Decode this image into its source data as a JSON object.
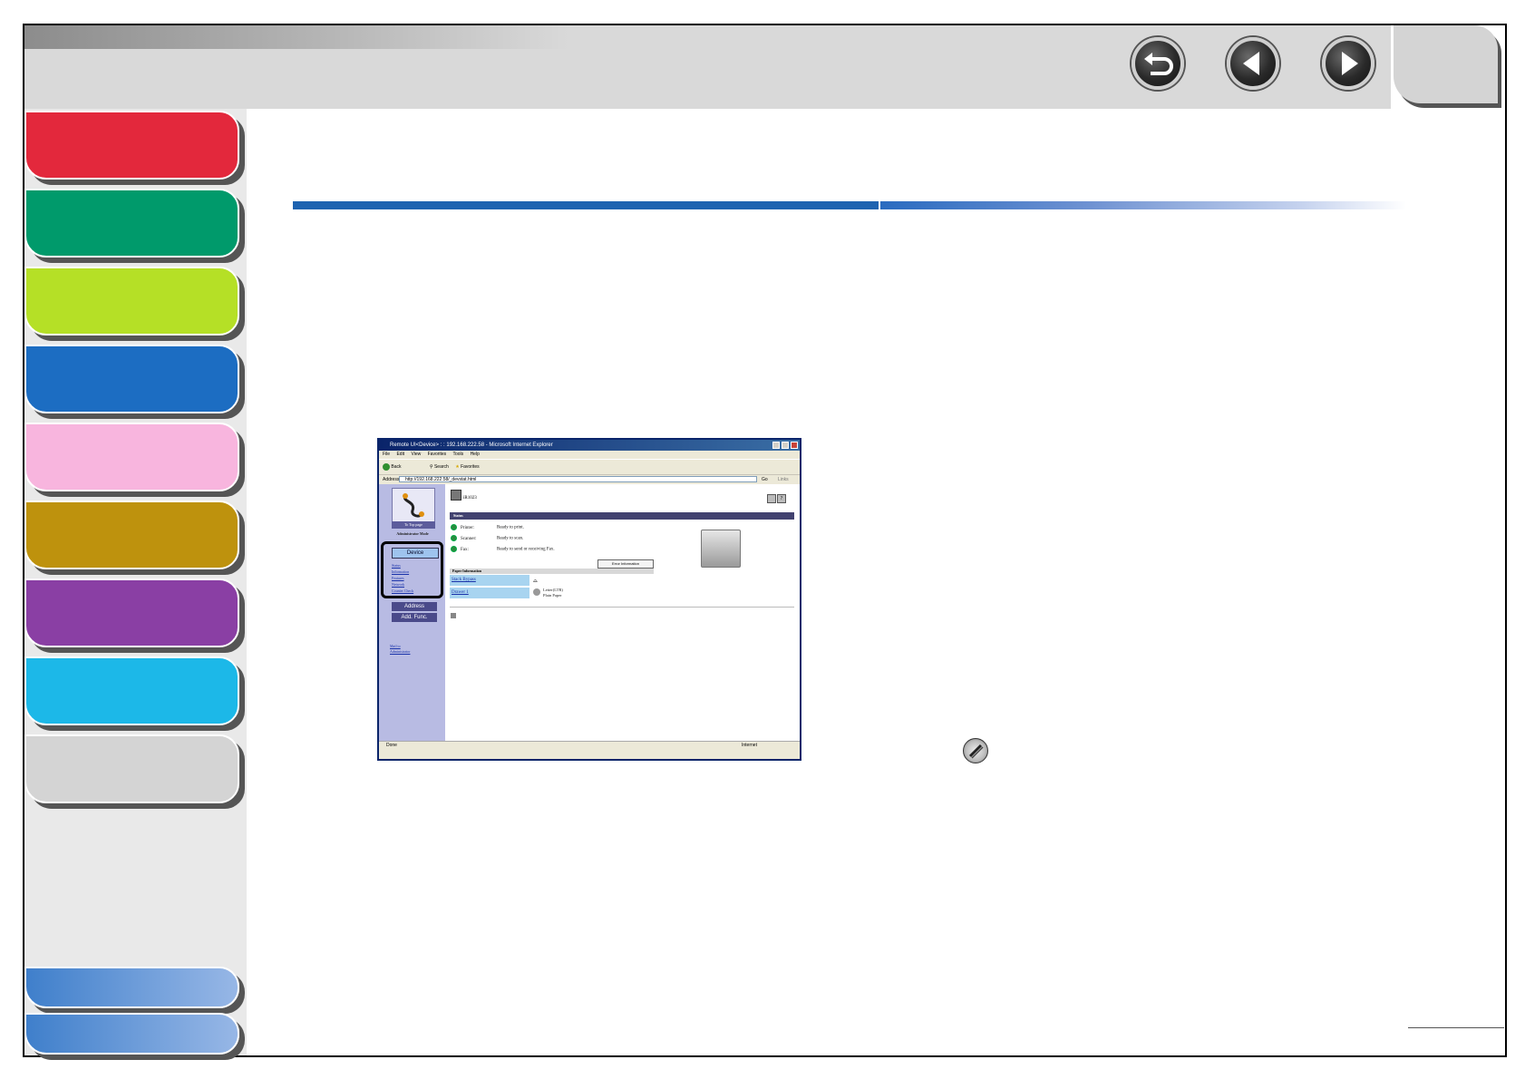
{
  "header": {
    "nav_buttons": [
      {
        "name": "back-icon",
        "glyph": "↺"
      },
      {
        "name": "previous-page-icon",
        "glyph": "◀"
      },
      {
        "name": "next-page-icon",
        "glyph": "▶"
      }
    ]
  },
  "sidebar": {
    "tab_colors": [
      "#e3283c",
      "#009a6b",
      "#b5e026",
      "#1c6dc2",
      "#f8b5de",
      "#be920d",
      "#8a3fa4",
      "#1cb8e8",
      "#d4d4d4"
    ],
    "bottom_tab_colors": [
      "#4a88d0",
      "#4a88d0"
    ]
  },
  "browser": {
    "title": "Remote UI<Device> : : 192.168.222.58 - Microsoft Internet Explorer",
    "menu": [
      "File",
      "Edit",
      "View",
      "Favorites",
      "Tools",
      "Help"
    ],
    "toolbar": {
      "back": "Back",
      "search": "Search",
      "favorites": "Favorites"
    },
    "address_label": "Address",
    "address": "http://192.168.222.58/_devstat.html",
    "go_label": "Go",
    "links_label": "Links",
    "status_left": "Done",
    "status_right": "Internet"
  },
  "remote_ui": {
    "top_page_label": "To Top page",
    "mode_label": "Administrator Mode",
    "device_button": "Device",
    "device_links": [
      "Status",
      "Information",
      "Features",
      "Network",
      "Counter Check"
    ],
    "address_button": "Address",
    "add_func_button": "Add. Func.",
    "manage_link": [
      "Mail to",
      "Administrator"
    ],
    "model": "iR1023",
    "status_heading": "Status",
    "status_rows": [
      {
        "label": "Printer:",
        "value": "Ready to print."
      },
      {
        "label": "Scanner:",
        "value": "Ready to scan."
      },
      {
        "label": "Fax:",
        "value": "Ready to send or receiving Fax."
      }
    ],
    "error_button": "Error Information",
    "paper_heading": "Paper Information",
    "paper_rows": [
      {
        "source": "Stack Bypass",
        "value": ""
      },
      {
        "source": "Drawer 1",
        "value": "Letter(LTR)",
        "value2": "Plain Paper"
      }
    ]
  }
}
